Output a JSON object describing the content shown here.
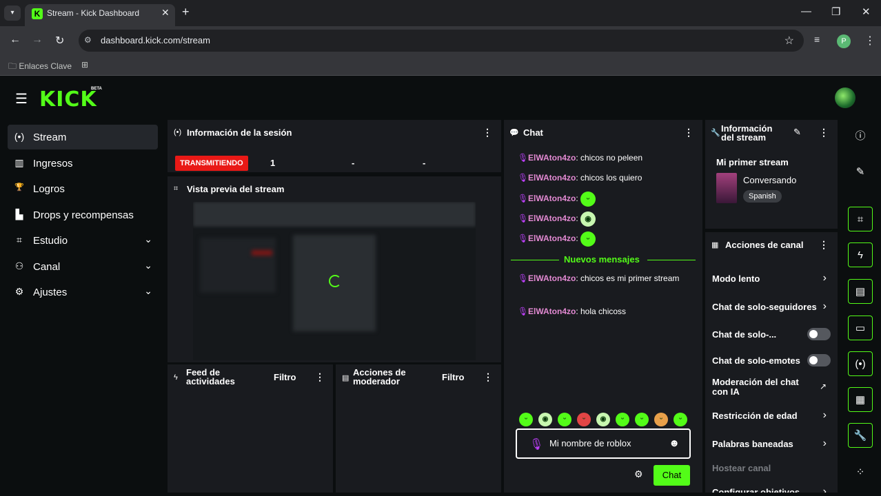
{
  "browser": {
    "tab_title": "Stream - Kick Dashboard",
    "tab_favicon": "K",
    "url": "dashboard.kick.com/stream",
    "bookmark_label": "Enlaces Clave",
    "profile_initial": "P"
  },
  "app": {
    "logo": "KICK",
    "beta": "BETA"
  },
  "sidebar": {
    "items": [
      {
        "label": "Stream",
        "icon": "broadcast-icon",
        "glyph": "(•)",
        "active": true
      },
      {
        "label": "Ingresos",
        "icon": "bar-chart-icon",
        "glyph": "▥"
      },
      {
        "label": "Logros",
        "icon": "trophy-icon",
        "glyph": "🏆"
      },
      {
        "label": "Drops y recompensas",
        "icon": "gift-icon",
        "glyph": "▙"
      },
      {
        "label": "Estudio",
        "icon": "studio-icon",
        "glyph": "⌗",
        "expandable": true
      },
      {
        "label": "Canal",
        "icon": "users-icon",
        "glyph": "⚇",
        "expandable": true
      },
      {
        "label": "Ajustes",
        "icon": "gear-icon",
        "glyph": "⚙",
        "expandable": true
      }
    ]
  },
  "session": {
    "title": "Información de la sesión",
    "status": "TRANSMITIENDO",
    "viewers": "1",
    "stat2": "-",
    "stat3": "-"
  },
  "preview": {
    "title": "Vista previa del stream"
  },
  "feed": {
    "title": "Feed de actividades",
    "filter": "Filtro"
  },
  "modactions": {
    "title": "Acciones de moderador",
    "filter": "Filtro"
  },
  "chat": {
    "title": "Chat",
    "messages": [
      {
        "user": "ElWAton4zo",
        "text": ": chicos no peleen"
      },
      {
        "user": "ElWAton4zo",
        "text": ": chicos los quiero"
      },
      {
        "user": "ElWAton4zo",
        "text": ":",
        "emote": true
      },
      {
        "user": "ElWAton4zo",
        "text": ":",
        "emote": true
      },
      {
        "user": "ElWAton4zo",
        "text": ":",
        "emote": true
      }
    ],
    "new_messages_label": "Nuevos mensajes",
    "new_messages": [
      {
        "user": "ElWAton4zo",
        "text": ": chicos es mi primer stream"
      },
      {
        "user": "ElWAton4zo",
        "text": ": hola chicoss"
      }
    ],
    "input_value": "Mi nombre de roblox",
    "send_label": "Chat"
  },
  "stream_info": {
    "title": "Información del stream",
    "stream_title": "Mi primer stream",
    "category": "Conversando",
    "language": "Spanish"
  },
  "channel_actions": {
    "title": "Acciones de canal",
    "items": [
      {
        "label": "Modo lento",
        "kind": "chevron"
      },
      {
        "label": "Chat de solo-seguidores",
        "kind": "chevron"
      },
      {
        "label": "Chat de solo-...",
        "kind": "toggle"
      },
      {
        "label": "Chat de solo-emotes",
        "kind": "toggle"
      },
      {
        "label": "Moderación del chat con IA",
        "kind": "external"
      },
      {
        "label": "Restricción de edad",
        "kind": "chevron"
      },
      {
        "label": "Palabras baneadas",
        "kind": "chevron"
      },
      {
        "label": "Hostear canal",
        "kind": "disabled"
      },
      {
        "label": "Configurar objetivos",
        "kind": "chevron"
      }
    ]
  },
  "colors": {
    "accent": "#53fc18",
    "live": "#e91916",
    "username": "#e38ad3",
    "panel": "#191b1f"
  }
}
